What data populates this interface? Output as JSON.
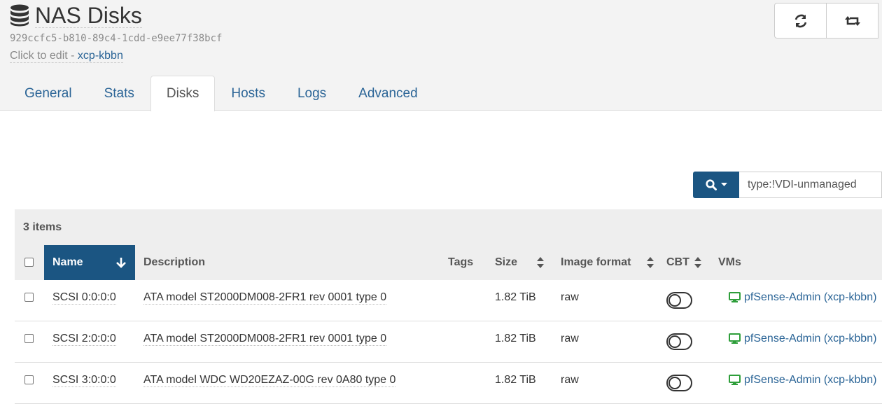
{
  "header": {
    "title": "NAS Disks",
    "uuid": "929ccfc5-b810-89c4-1cdd-e9ee77f38bcf",
    "edit_prefix": "Click to edit",
    "separator": " - ",
    "host_link": "xcp-kbbn",
    "icons": [
      "database-icon",
      "refresh-icon",
      "retweet-icon"
    ]
  },
  "tabs": [
    {
      "label": "General",
      "active": false
    },
    {
      "label": "Stats",
      "active": false
    },
    {
      "label": "Disks",
      "active": true
    },
    {
      "label": "Hosts",
      "active": false
    },
    {
      "label": "Logs",
      "active": false
    },
    {
      "label": "Advanced",
      "active": false
    }
  ],
  "filter": {
    "value": "type:!VDI-unmanaged",
    "icons": [
      "search-icon",
      "caret-down-icon"
    ]
  },
  "table": {
    "item_count": "3 items",
    "columns": [
      "Name",
      "Description",
      "Tags",
      "Size",
      "Image format",
      "CBT",
      "VMs"
    ],
    "sorted_column": "Name",
    "rows": [
      {
        "name": "SCSI 0:0:0:0",
        "description": "ATA model ST2000DM008-2FR1 rev 0001 type 0",
        "size": "1.82 TiB",
        "format": "raw",
        "cbt": false,
        "vm": "pfSense-Admin (xcp-kbbn)"
      },
      {
        "name": "SCSI 2:0:0:0",
        "description": "ATA model ST2000DM008-2FR1 rev 0001 type 0",
        "size": "1.82 TiB",
        "format": "raw",
        "cbt": false,
        "vm": "pfSense-Admin (xcp-kbbn)"
      },
      {
        "name": "SCSI 3:0:0:0",
        "description": "ATA model WDC WD20EZAZ-00G rev 0A80 type 0",
        "size": "1.82 TiB",
        "format": "raw",
        "cbt": false,
        "vm": "pfSense-Admin (xcp-kbbn)"
      }
    ]
  },
  "colors": {
    "primary": "#1b5582",
    "link": "#2a6496",
    "vm_icon": "#2e9e3a"
  }
}
